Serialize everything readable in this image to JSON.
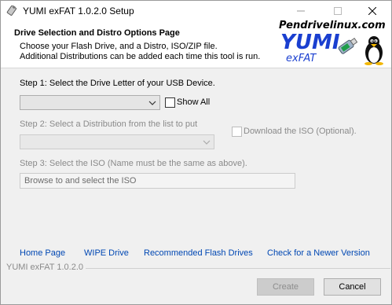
{
  "window": {
    "title": "YUMI exFAT 1.0.2.0 Setup"
  },
  "header": {
    "title": "Drive Selection and Distro Options Page",
    "subtitle_line1": "Choose your Flash Drive, and a Distro, ISO/ZIP file.",
    "subtitle_line2": "Additional Distributions can be added each time this tool is run.",
    "logo": {
      "url_text": "Pendrivelinux.com",
      "brand": "YUMI",
      "edition": "exFAT"
    }
  },
  "step1": {
    "label": "Step 1: Select the Drive Letter of your USB Device.",
    "drive_value": "",
    "show_all_label": "Show All",
    "show_all_checked": false
  },
  "step2": {
    "label": "Step 2: Select a Distribution from the list to put",
    "distro_value": "",
    "download_iso_label": "Download the ISO (Optional).",
    "download_iso_checked": false
  },
  "step3": {
    "label": "Step 3: Select the ISO (Name must be the same as above).",
    "browse_text": "Browse to and select the ISO"
  },
  "links": {
    "home": "Home Page",
    "wipe": "WIPE Drive",
    "flash": "Recommended Flash Drives",
    "update": "Check for a Newer Version"
  },
  "footer": {
    "version": "YUMI exFAT 1.0.2.0"
  },
  "buttons": {
    "create": "Create",
    "cancel": "Cancel"
  },
  "colors": {
    "link": "#0047b3",
    "brand_blue": "#1a3fd0"
  }
}
